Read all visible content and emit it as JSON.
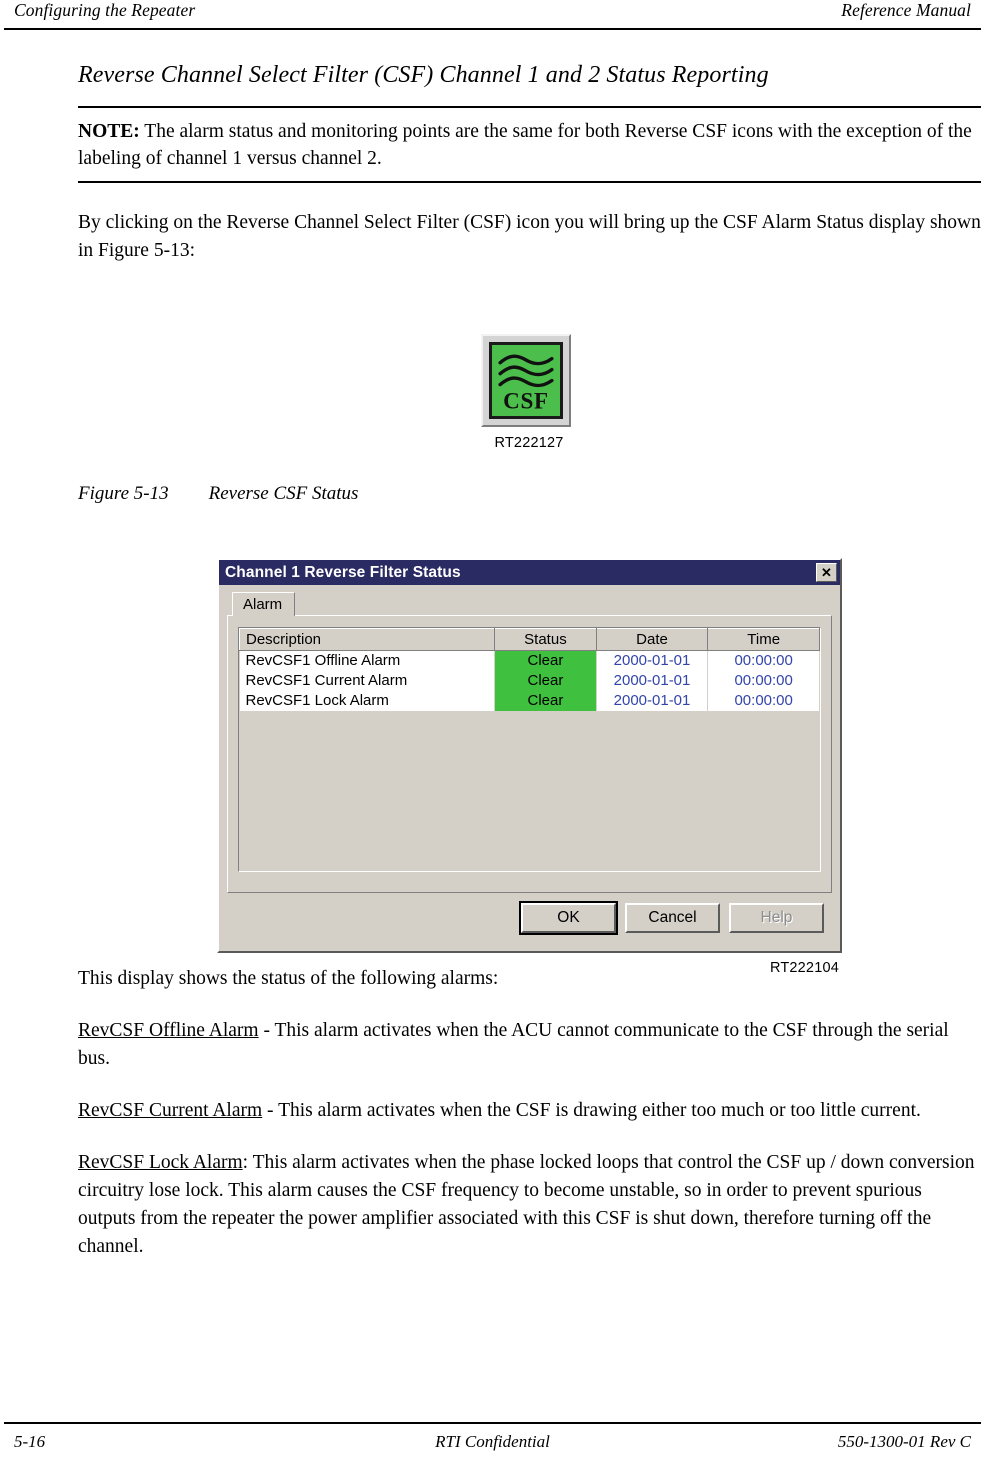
{
  "header": {
    "left": "Configuring the Repeater",
    "right": "Reference Manual"
  },
  "section": {
    "title": "Reverse Channel Select Filter (CSF) Channel 1 and 2 Status Reporting"
  },
  "note": {
    "label": "NOTE:",
    "text": "  The alarm status and monitoring points are the same for both Reverse CSF icons with the exception of the labeling of channel 1 versus channel 2."
  },
  "intro_paragraph": "By clicking on the Reverse Channel Select Filter (CSF) icon you will bring up the CSF Alarm Status display shown in Figure 5-13:",
  "icon_figure": {
    "icon_label": "CSF",
    "icon_color": "#4cbe4c",
    "rt_number": "RT222127"
  },
  "figure_caption": {
    "number": "Figure 5-13",
    "title": "Reverse CSF Status"
  },
  "dialog": {
    "title": "Channel 1 Reverse Filter Status",
    "close_label": "✕",
    "titlebar_color": "#2b2b63",
    "tabs": [
      {
        "label": "Alarm",
        "selected": true
      }
    ],
    "grid": {
      "columns": [
        "Description",
        "Status",
        "Date",
        "Time"
      ],
      "rows": [
        {
          "description": "RevCSF1 Offline Alarm",
          "status": "Clear",
          "status_color": "#3fc13f",
          "date": "2000-01-01",
          "time": "00:00:00"
        },
        {
          "description": "RevCSF1 Current Alarm",
          "status": "Clear",
          "status_color": "#3fc13f",
          "date": "2000-01-01",
          "time": "00:00:00"
        },
        {
          "description": "RevCSF1 Lock Alarm",
          "status": "Clear",
          "status_color": "#3fc13f",
          "date": "2000-01-01",
          "time": "00:00:00"
        }
      ]
    },
    "buttons": {
      "ok": "OK",
      "cancel": "Cancel",
      "help": "Help"
    },
    "rt_number": "RT222104"
  },
  "body": {
    "intro": "This display shows the status of the following alarms:",
    "alarms": [
      {
        "term": "RevCSF Offline Alarm",
        "description": " - This alarm activates when the ACU cannot communicate to the CSF through the serial bus."
      },
      {
        "term": "RevCSF Current Alarm",
        "description": " - This alarm activates when the CSF is drawing either too much or too little current."
      },
      {
        "term": "RevCSF Lock Alarm",
        "description": ": This alarm activates when the phase locked loops that control the CSF up / down conversion circuitry lose lock. This alarm causes the CSF frequency to become unstable, so in order to prevent spurious outputs from the repeater the power amplifier associated with this CSF is shut down, therefore turning off the channel."
      }
    ]
  },
  "footer": {
    "page": "5-16",
    "center": "RTI Confidential",
    "doc": "550-1300-01 Rev C"
  }
}
